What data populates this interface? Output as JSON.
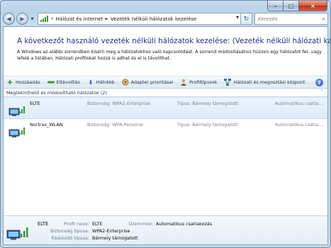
{
  "window": {
    "caption": {
      "minimize": "–",
      "maximize": "□",
      "close": "×"
    }
  },
  "nav": {
    "back": "◀",
    "forward": "▶",
    "breadcrumb_root_sep": "«",
    "breadcrumb": [
      "Hálózat és internet",
      "Vezeték nélküli hálózatok kezelése"
    ],
    "crumb_sep": "►",
    "search_placeholder": "Keresés"
  },
  "page": {
    "title": "A következőt használó vezeték nélküli hálózatok kezelése: (Vezeték nélküli hálózati kapcsolat)",
    "description": "A Windows az alábbi sorrendben kísérli meg a hálózatokhoz való kapcsolódást. A sorrend módosításához húzzon egy hálózatot fel- vagy lefelé a listában. Hálózati profilokat hozzá is adhat és el is távolíthat."
  },
  "toolbar": {
    "items": [
      {
        "label": "Hozzáadás",
        "icon": "add-icon",
        "color": "#3a9c2e"
      },
      {
        "label": "Eltávolítás",
        "icon": "remove-icon",
        "color": "#3a9c2e"
      },
      {
        "label": "Hátrébb",
        "icon": "move-down-icon",
        "color": "#2e6fcf"
      },
      {
        "label": "Adapter prioritásai",
        "icon": "adapter-icon",
        "color": "#8d6a2b"
      },
      {
        "label": "Profiltípusok",
        "icon": "profile-types-icon",
        "color": "#c4862a"
      },
      {
        "label": "Hálózati és megosztási központ",
        "icon": "network-center-icon",
        "color": "#3b6fb5"
      }
    ],
    "help": "?"
  },
  "list": {
    "group_header": "Megtekinthető és módosítható hálózatok (2)",
    "collapse_glyph": "ˆ",
    "rows": [
      {
        "name": "ELTE",
        "security": "Biztonság: WPA2-Enterprise",
        "type": "Típus: Bármely támogatott",
        "mode": "Automatikus csatla..."
      },
      {
        "name": "Nortrax_WLAN",
        "security": "Biztonság: WPA-Personal",
        "type": "Típus: Bármely támogatott",
        "mode": "Automatikus csatla..."
      }
    ]
  },
  "details": {
    "name": "ELTE",
    "profile_label": "Profil neve:",
    "profile_value": "ELTE",
    "security_label": "Biztonság típusa:",
    "security_value": "WPA2-Enterprise",
    "radio_label": "Rádióadó típusa:",
    "radio_value": "Bármely támogatott",
    "mode_label": "Üzemmód:",
    "mode_value": "Automatikus csatlakozás"
  }
}
